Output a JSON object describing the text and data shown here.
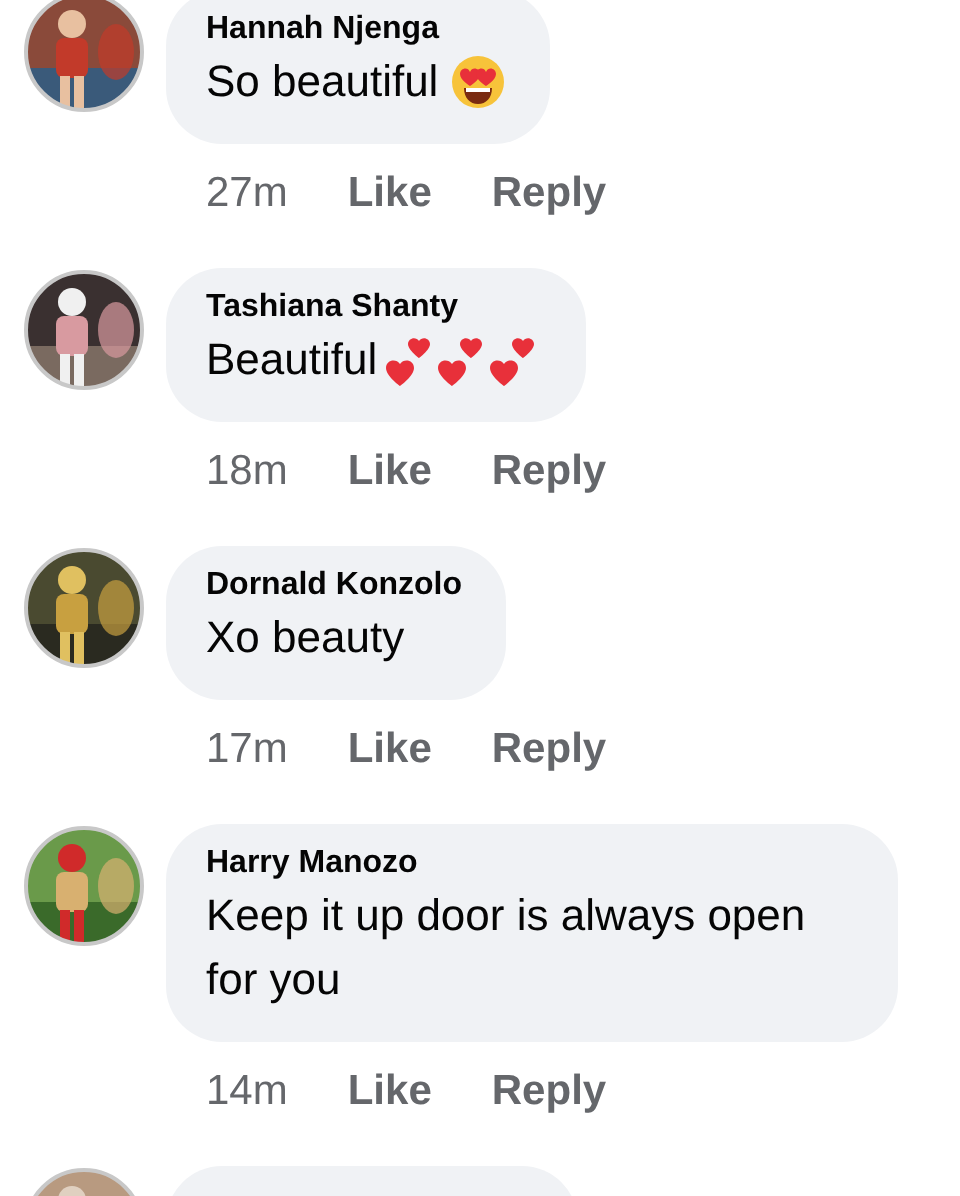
{
  "comments": [
    {
      "kind": "full",
      "author": "Hannah Njenga",
      "text": "So beautiful",
      "emojis": [
        {
          "kind": "heart_eyes"
        }
      ],
      "time": "27m",
      "like": "Like",
      "reply": "Reply"
    },
    {
      "kind": "full",
      "author": "Tashiana Shanty",
      "text": "Beautiful",
      "emojis": [
        {
          "kind": "two_hearts"
        },
        {
          "kind": "two_hearts"
        },
        {
          "kind": "two_hearts"
        }
      ],
      "time": "18m",
      "like": "Like",
      "reply": "Reply"
    },
    {
      "kind": "full",
      "author": "Dornald Konzolo",
      "text": "Xo beauty",
      "time": "17m",
      "like": "Like",
      "reply": "Reply"
    },
    {
      "kind": "full",
      "author": "Harry Manozo",
      "text": "Keep it up door is always open for you",
      "time": "14m",
      "like": "Like",
      "reply": "Reply"
    },
    {
      "kind": "cut"
    }
  ]
}
